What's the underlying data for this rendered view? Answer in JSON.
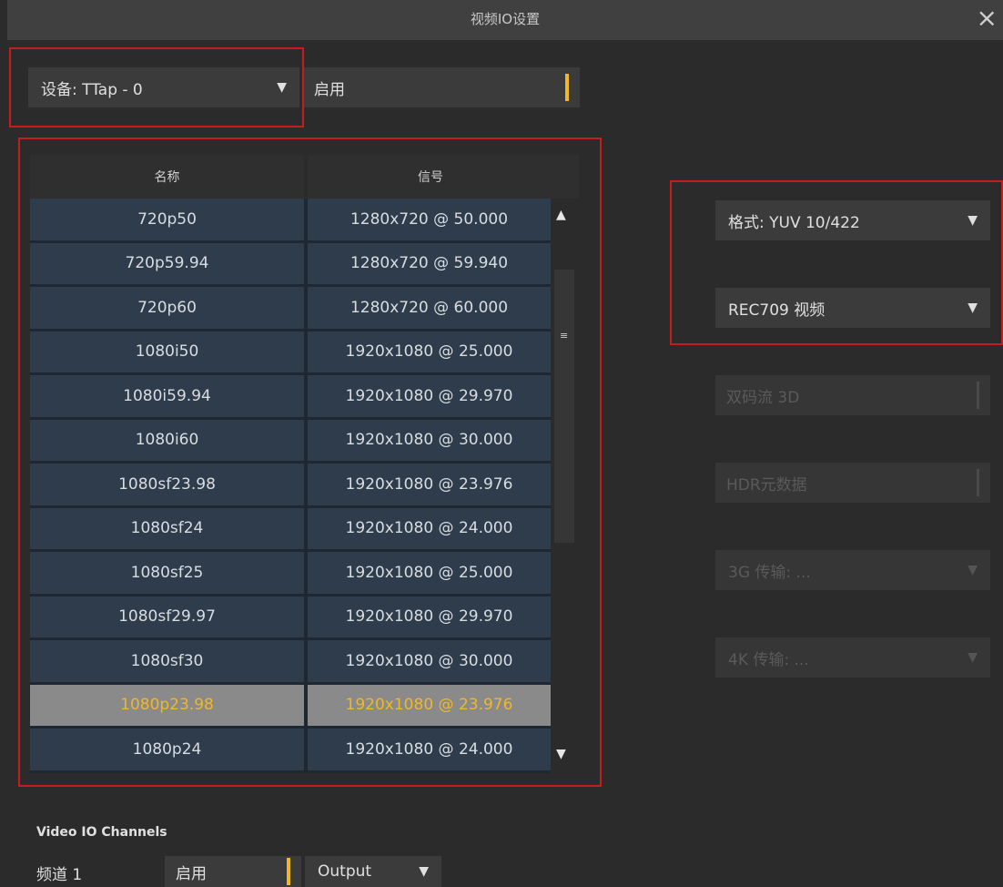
{
  "window": {
    "title": "视频IO设置",
    "close_icon": "×"
  },
  "device": {
    "label": "设备: TTap - 0",
    "arrow": "▼"
  },
  "enable_toggle": {
    "label": "启用"
  },
  "table": {
    "headers": [
      "名称",
      "信号"
    ],
    "rows": [
      {
        "name": "720p50",
        "signal": "1280x720 @ 50.000"
      },
      {
        "name": "720p59.94",
        "signal": "1280x720 @ 59.940"
      },
      {
        "name": "720p60",
        "signal": "1280x720 @ 60.000"
      },
      {
        "name": "1080i50",
        "signal": "1920x1080 @ 25.000"
      },
      {
        "name": "1080i59.94",
        "signal": "1920x1080 @ 29.970"
      },
      {
        "name": "1080i60",
        "signal": "1920x1080 @ 30.000"
      },
      {
        "name": "1080sf23.98",
        "signal": "1920x1080 @ 23.976"
      },
      {
        "name": "1080sf24",
        "signal": "1920x1080 @ 24.000"
      },
      {
        "name": "1080sf25",
        "signal": "1920x1080 @ 25.000"
      },
      {
        "name": "1080sf29.97",
        "signal": "1920x1080 @ 29.970"
      },
      {
        "name": "1080sf30",
        "signal": "1920x1080 @ 30.000"
      },
      {
        "name": "1080p23.98",
        "signal": "1920x1080 @ 23.976",
        "selected": true
      },
      {
        "name": "1080p24",
        "signal": "1920x1080 @ 24.000"
      }
    ],
    "scroll_up": "▲",
    "scroll_down": "▼",
    "scroll_grip": "≡"
  },
  "right_panel": {
    "format": {
      "label": "格式: YUV 10/422",
      "arrow": "▼"
    },
    "color": {
      "label": "REC709 视频",
      "arrow": "▼"
    },
    "dual_stream": {
      "label": "双码流 3D"
    },
    "hdr_meta": {
      "label": "HDR元数据"
    },
    "transport_3g": {
      "label": "3G 传输: ...",
      "arrow": "▼"
    },
    "transport_4k": {
      "label": "4K 传输: ...",
      "arrow": "▼"
    }
  },
  "channels": {
    "section_title": "Video IO Channels",
    "channel_label": "频道 1",
    "enable_label": "启用",
    "direction": {
      "label": "Output",
      "arrow": "▼"
    }
  },
  "colors": {
    "accent": "#f0b825",
    "highlight_border": "#c41d1d",
    "row_bg": "#2e3c4b",
    "selected_row_bg": "#8a8a8a"
  }
}
